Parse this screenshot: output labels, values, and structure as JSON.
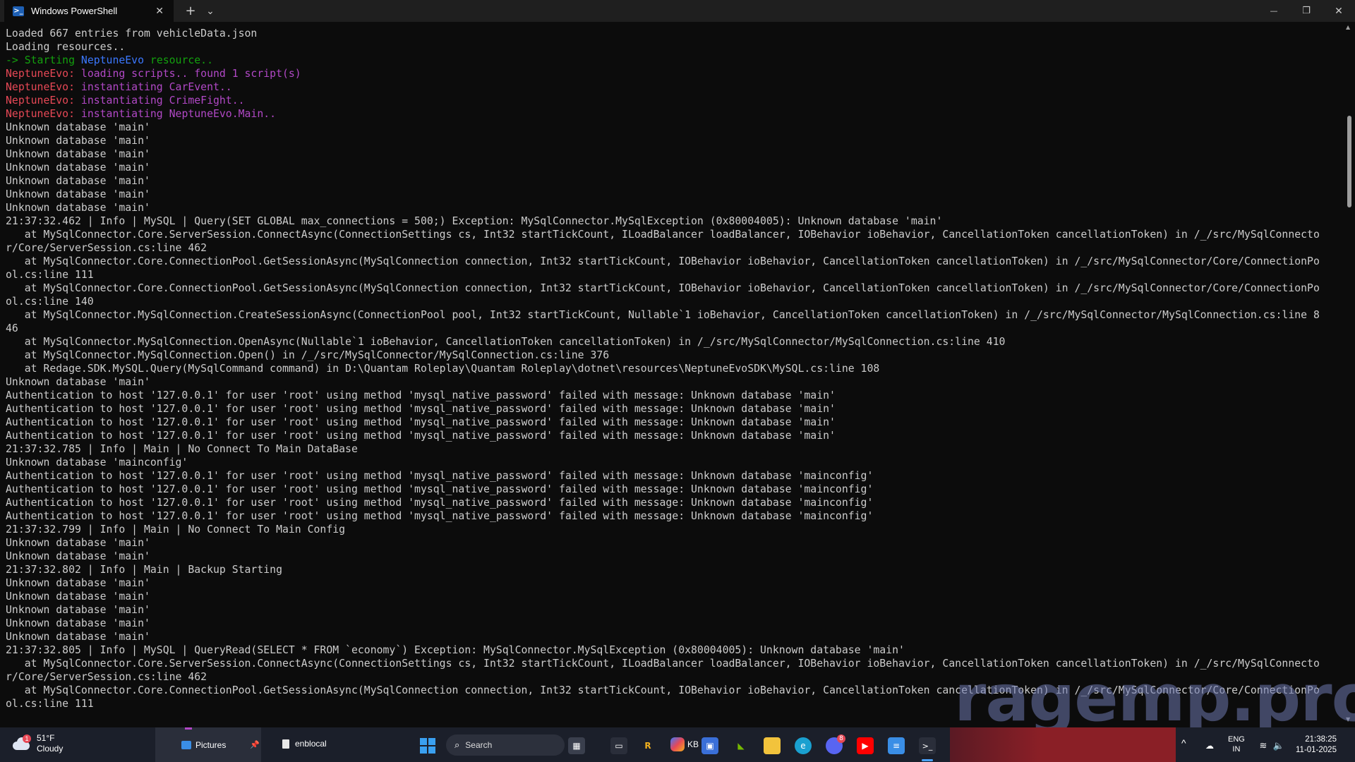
{
  "window": {
    "tab_title": "Windows PowerShell",
    "new_tab": "+",
    "dropdown": "⌄",
    "minimize": "—",
    "maximize": "❐",
    "close": "✕"
  },
  "console_lines": [
    [
      {
        "t": "Loaded 667 entries from vehicleData.json",
        "c": "#cccccc"
      }
    ],
    [
      {
        "t": "Loading resources..",
        "c": "#cccccc"
      }
    ],
    [
      {
        "t": "-> Starting ",
        "c": "#13a10e"
      },
      {
        "t": "NeptuneEvo",
        "c": "#3b78ff"
      },
      {
        "t": " resource..",
        "c": "#13a10e"
      }
    ],
    [
      {
        "t": "NeptuneEvo: ",
        "c": "#e74856"
      },
      {
        "t": "loading scripts.. found 1 script(s)",
        "c": "#b148c6"
      }
    ],
    [
      {
        "t": "NeptuneEvo: ",
        "c": "#e74856"
      },
      {
        "t": "instantiating CarEvent..",
        "c": "#b148c6"
      }
    ],
    [
      {
        "t": "NeptuneEvo: ",
        "c": "#e74856"
      },
      {
        "t": "instantiating CrimeFight..",
        "c": "#b148c6"
      }
    ],
    [
      {
        "t": "NeptuneEvo: ",
        "c": "#e74856"
      },
      {
        "t": "instantiating NeptuneEvo.Main..",
        "c": "#b148c6"
      }
    ],
    [
      {
        "t": "Unknown database 'main'",
        "c": "#cccccc"
      }
    ],
    [
      {
        "t": "Unknown database 'main'",
        "c": "#cccccc"
      }
    ],
    [
      {
        "t": "Unknown database 'main'",
        "c": "#cccccc"
      }
    ],
    [
      {
        "t": "Unknown database 'main'",
        "c": "#cccccc"
      }
    ],
    [
      {
        "t": "Unknown database 'main'",
        "c": "#cccccc"
      }
    ],
    [
      {
        "t": "Unknown database 'main'",
        "c": "#cccccc"
      }
    ],
    [
      {
        "t": "Unknown database 'main'",
        "c": "#cccccc"
      }
    ],
    [
      {
        "t": "21:37:32.462 | Info | MySQL | Query(SET GLOBAL max_connections = 500;) Exception: MySqlConnector.MySqlException (0x80004005): Unknown database 'main'",
        "c": "#cccccc"
      }
    ],
    [
      {
        "t": "   at MySqlConnector.Core.ServerSession.ConnectAsync(ConnectionSettings cs, Int32 startTickCount, ILoadBalancer loadBalancer, IOBehavior ioBehavior, CancellationToken cancellationToken) in /_/src/MySqlConnecto",
        "c": "#cccccc"
      }
    ],
    [
      {
        "t": "r/Core/ServerSession.cs:line 462",
        "c": "#cccccc"
      }
    ],
    [
      {
        "t": "   at MySqlConnector.Core.ConnectionPool.GetSessionAsync(MySqlConnection connection, Int32 startTickCount, IOBehavior ioBehavior, CancellationToken cancellationToken) in /_/src/MySqlConnector/Core/ConnectionPo",
        "c": "#cccccc"
      }
    ],
    [
      {
        "t": "ol.cs:line 111",
        "c": "#cccccc"
      }
    ],
    [
      {
        "t": "   at MySqlConnector.Core.ConnectionPool.GetSessionAsync(MySqlConnection connection, Int32 startTickCount, IOBehavior ioBehavior, CancellationToken cancellationToken) in /_/src/MySqlConnector/Core/ConnectionPo",
        "c": "#cccccc"
      }
    ],
    [
      {
        "t": "ol.cs:line 140",
        "c": "#cccccc"
      }
    ],
    [
      {
        "t": "   at MySqlConnector.MySqlConnection.CreateSessionAsync(ConnectionPool pool, Int32 startTickCount, Nullable`1 ioBehavior, CancellationToken cancellationToken) in /_/src/MySqlConnector/MySqlConnection.cs:line 8",
        "c": "#cccccc"
      }
    ],
    [
      {
        "t": "46",
        "c": "#cccccc"
      }
    ],
    [
      {
        "t": "   at MySqlConnector.MySqlConnection.OpenAsync(Nullable`1 ioBehavior, CancellationToken cancellationToken) in /_/src/MySqlConnector/MySqlConnection.cs:line 410",
        "c": "#cccccc"
      }
    ],
    [
      {
        "t": "   at MySqlConnector.MySqlConnection.Open() in /_/src/MySqlConnector/MySqlConnection.cs:line 376",
        "c": "#cccccc"
      }
    ],
    [
      {
        "t": "   at Redage.SDK.MySQL.Query(MySqlCommand command) in D:\\Quantam Roleplay\\Quantam Roleplay\\dotnet\\resources\\NeptuneEvoSDK\\MySQL.cs:line 108",
        "c": "#cccccc"
      }
    ],
    [
      {
        "t": "Unknown database 'main'",
        "c": "#cccccc"
      }
    ],
    [
      {
        "t": "Authentication to host '127.0.0.1' for user 'root' using method 'mysql_native_password' failed with message: Unknown database 'main'",
        "c": "#cccccc"
      }
    ],
    [
      {
        "t": "Authentication to host '127.0.0.1' for user 'root' using method 'mysql_native_password' failed with message: Unknown database 'main'",
        "c": "#cccccc"
      }
    ],
    [
      {
        "t": "Authentication to host '127.0.0.1' for user 'root' using method 'mysql_native_password' failed with message: Unknown database 'main'",
        "c": "#cccccc"
      }
    ],
    [
      {
        "t": "Authentication to host '127.0.0.1' for user 'root' using method 'mysql_native_password' failed with message: Unknown database 'main'",
        "c": "#cccccc"
      }
    ],
    [
      {
        "t": "21:37:32.785 | Info | Main | No Connect To Main DataBase",
        "c": "#cccccc"
      }
    ],
    [
      {
        "t": "Unknown database 'mainconfig'",
        "c": "#cccccc"
      }
    ],
    [
      {
        "t": "Authentication to host '127.0.0.1' for user 'root' using method 'mysql_native_password' failed with message: Unknown database 'mainconfig'",
        "c": "#cccccc"
      }
    ],
    [
      {
        "t": "Authentication to host '127.0.0.1' for user 'root' using method 'mysql_native_password' failed with message: Unknown database 'mainconfig'",
        "c": "#cccccc"
      }
    ],
    [
      {
        "t": "Authentication to host '127.0.0.1' for user 'root' using method 'mysql_native_password' failed with message: Unknown database 'mainconfig'",
        "c": "#cccccc"
      }
    ],
    [
      {
        "t": "Authentication to host '127.0.0.1' for user 'root' using method 'mysql_native_password' failed with message: Unknown database 'mainconfig'",
        "c": "#cccccc"
      }
    ],
    [
      {
        "t": "21:37:32.799 | Info | Main | No Connect To Main Config",
        "c": "#cccccc"
      }
    ],
    [
      {
        "t": "Unknown database 'main'",
        "c": "#cccccc"
      }
    ],
    [
      {
        "t": "Unknown database 'main'",
        "c": "#cccccc"
      }
    ],
    [
      {
        "t": "21:37:32.802 | Info | Main | Backup Starting",
        "c": "#cccccc"
      }
    ],
    [
      {
        "t": "Unknown database 'main'",
        "c": "#cccccc"
      }
    ],
    [
      {
        "t": "Unknown database 'main'",
        "c": "#cccccc"
      }
    ],
    [
      {
        "t": "Unknown database 'main'",
        "c": "#cccccc"
      }
    ],
    [
      {
        "t": "Unknown database 'main'",
        "c": "#cccccc"
      }
    ],
    [
      {
        "t": "Unknown database 'main'",
        "c": "#cccccc"
      }
    ],
    [
      {
        "t": "21:37:32.805 | Info | MySQL | QueryRead(SELECT * FROM `economy`) Exception: MySqlConnector.MySqlException (0x80004005): Unknown database 'main'",
        "c": "#cccccc"
      }
    ],
    [
      {
        "t": "   at MySqlConnector.Core.ServerSession.ConnectAsync(ConnectionSettings cs, Int32 startTickCount, ILoadBalancer loadBalancer, IOBehavior ioBehavior, CancellationToken cancellationToken) in /_/src/MySqlConnecto",
        "c": "#cccccc"
      }
    ],
    [
      {
        "t": "r/Core/ServerSession.cs:line 462",
        "c": "#cccccc"
      }
    ],
    [
      {
        "t": "   at MySqlConnector.Core.ConnectionPool.GetSessionAsync(MySqlConnection connection, Int32 startTickCount, IOBehavior ioBehavior, CancellationToken cancellationToken) in /_/src/MySqlConnector/Core/ConnectionPo",
        "c": "#cccccc"
      }
    ],
    [
      {
        "t": "ol.cs:line 111",
        "c": "#cccccc"
      }
    ]
  ],
  "watermark": "ragemp.pro",
  "taskbar": {
    "weather_temp": "51°F",
    "weather_desc": "Cloudy",
    "weather_badge": "1",
    "pictures_label": "Pictures",
    "enblocal_label": "enblocal",
    "search_text": "Search",
    "kb_label": "KB",
    "discord_badge": "8",
    "lang_top": "ENG",
    "lang_bottom": "IN",
    "time": "21:38:25",
    "date": "11-01-2025",
    "tray_expand": "^"
  },
  "colors": {
    "console_bg": "#0c0c0c",
    "default_text": "#cccccc",
    "green": "#13a10e",
    "blue": "#3b78ff",
    "red": "#e74856",
    "magenta": "#b148c6"
  }
}
